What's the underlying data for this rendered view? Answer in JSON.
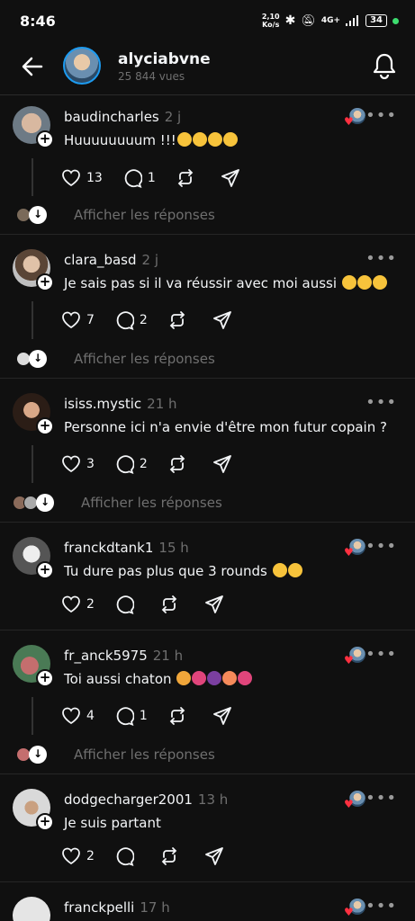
{
  "status": {
    "time": "8:46",
    "speed_top": "2,10",
    "speed_bottom": "Ko/s",
    "network": "4G+",
    "battery": "34"
  },
  "header": {
    "username": "alyciabvne",
    "views": "25 844 vues"
  },
  "replies_label": "Afficher les réponses",
  "comments": [
    {
      "user": "baudincharles",
      "time": "2 j",
      "text": "Huuuuuuuum !!!",
      "likes": "13",
      "replies": "1"
    },
    {
      "user": "clara_basd",
      "time": "2 j",
      "text": "Je sais pas si il va réussir avec moi aussi",
      "likes": "7",
      "replies": "2"
    },
    {
      "user": "isiss.mystic",
      "time": "21 h",
      "text": "Personne ici n'a envie d'être mon futur copain ?",
      "likes": "3",
      "replies": "2"
    },
    {
      "user": "franckdtank1",
      "time": "15 h",
      "text": "Tu dure pas plus que 3 rounds",
      "likes": "2",
      "replies": ""
    },
    {
      "user": "fr_anck5975",
      "time": "21 h",
      "text": "Toi aussi chaton",
      "likes": "4",
      "replies": "1"
    },
    {
      "user": "dodgecharger2001",
      "time": "13 h",
      "text": "Je suis partant",
      "likes": "2",
      "replies": ""
    },
    {
      "user": "franckpelli",
      "time": "17 h",
      "text": "",
      "likes": "",
      "replies": ""
    }
  ],
  "colors": {
    "background": "#101010",
    "muted": "#6f6f6f",
    "like": "#ff3040"
  }
}
